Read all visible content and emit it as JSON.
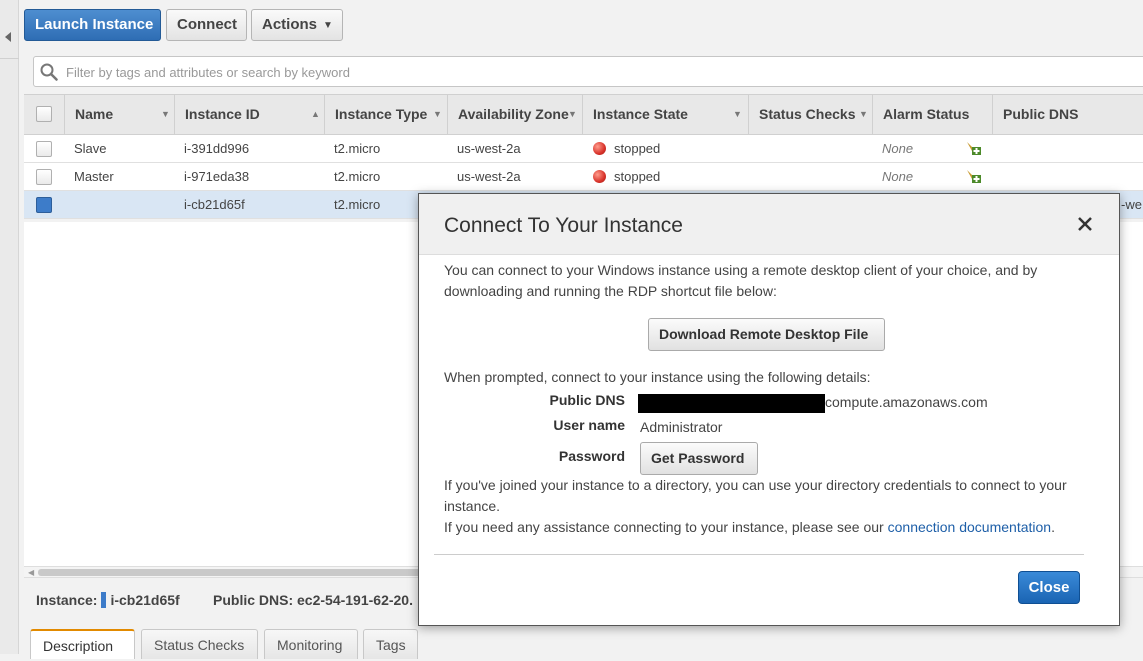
{
  "toolbar": {
    "launch_label": "Launch Instance",
    "connect_label": "Connect",
    "actions_label": "Actions"
  },
  "search": {
    "placeholder": "Filter by tags and attributes or search by keyword"
  },
  "table": {
    "columns": [
      "Name",
      "Instance ID",
      "Instance Type",
      "Availability Zone",
      "Instance State",
      "Status Checks",
      "Alarm Status",
      "Public DNS"
    ],
    "rows": [
      {
        "name": "Slave",
        "instance_id": "i-391dd996",
        "type": "t2.micro",
        "zone": "us-west-2a",
        "state": "stopped",
        "status_checks": "",
        "alarm": "None",
        "public_dns": ""
      },
      {
        "name": "Master",
        "instance_id": "i-971eda38",
        "type": "t2.micro",
        "zone": "us-west-2a",
        "state": "stopped",
        "status_checks": "",
        "alarm": "None",
        "public_dns": ""
      },
      {
        "name": "",
        "instance_id": "i-cb21d65f",
        "type": "t2.micro",
        "zone": "",
        "state": "",
        "status_checks": "",
        "alarm": "",
        "public_dns": "-we"
      }
    ]
  },
  "details": {
    "instance_label": "Instance:",
    "instance_id": "i-cb21d65f",
    "dns_label": "Public DNS:",
    "dns_value": "ec2-54-191-62-20."
  },
  "tabs": [
    "Description",
    "Status Checks",
    "Monitoring",
    "Tags"
  ],
  "modal": {
    "title": "Connect To Your Instance",
    "intro": "You can connect to your Windows instance using a remote desktop client of your choice, and by downloading and running the RDP shortcut file below:",
    "download_label": "Download Remote Desktop File",
    "prompt": "When prompted, connect to your instance using the following details:",
    "dns_label": "Public DNS",
    "dns_suffix": "compute.amazonaws.com",
    "user_label": "User name",
    "user_value": "Administrator",
    "password_label": "Password",
    "get_password_label": "Get Password",
    "directory_text": "If you've joined your instance to a directory, you can use your directory credentials to connect to your instance.",
    "assist_text": "If you need any assistance connecting to your instance, please see our",
    "assist_link": "connection documentation",
    "assist_end": ".",
    "close_label": "Close"
  },
  "colors": {
    "primary": "#2e6db4",
    "stopped": "#d8322a",
    "tab_accent": "#e28a00",
    "link": "#1e5fa8"
  },
  "icons": {
    "search": "search-icon",
    "close": "close-icon",
    "alarm": "alarm-add-icon",
    "state": "stopped-state-icon"
  }
}
